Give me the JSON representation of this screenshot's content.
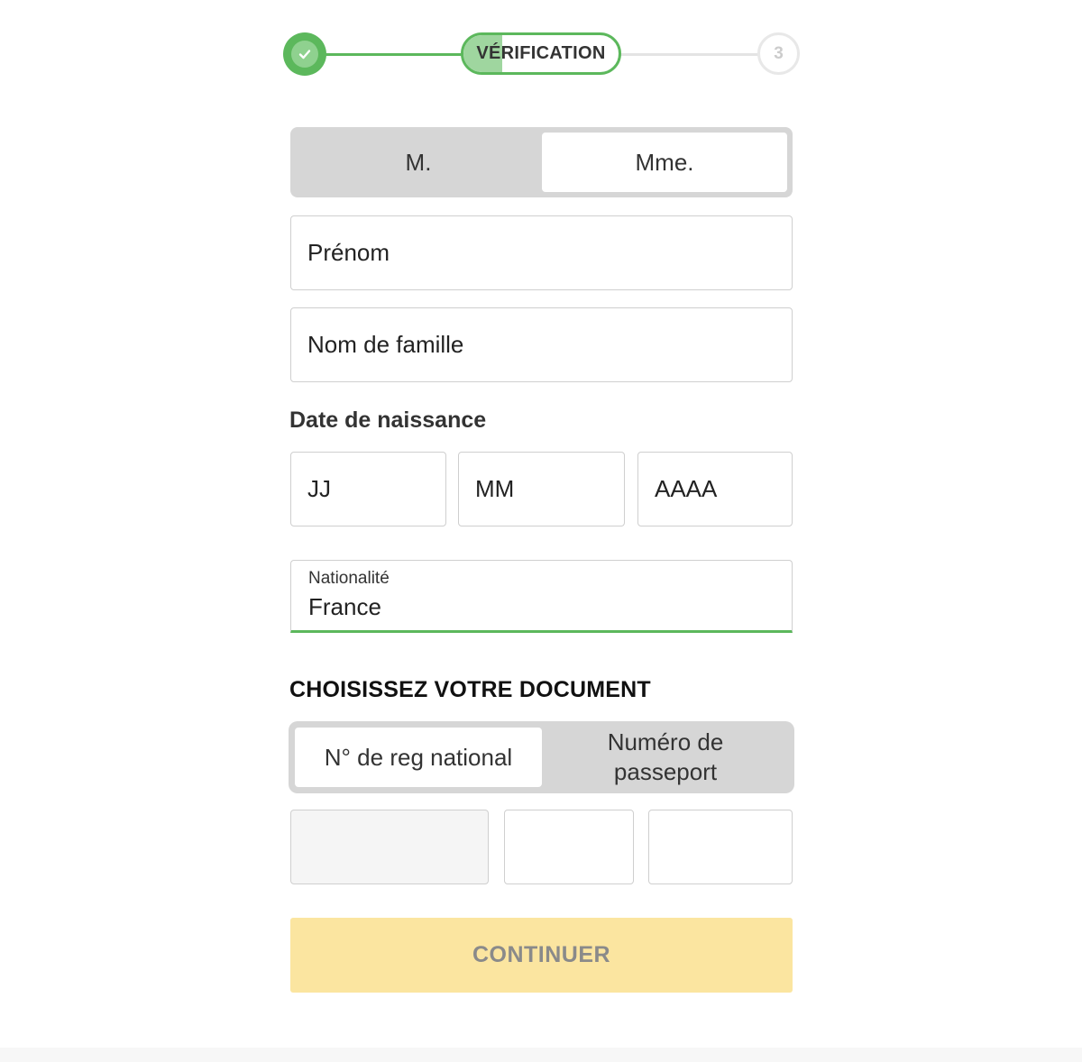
{
  "stepper": {
    "current_label": "VÉRIFICATION",
    "future_step_number": "3",
    "completed_icon": "check-icon",
    "current_progress_percent": 25
  },
  "civility": {
    "options": [
      "M.",
      "Mme."
    ],
    "selected": "Mme."
  },
  "form": {
    "first_name_placeholder": "Prénom",
    "last_name_placeholder": "Nom de famille",
    "birth_date_label": "Date de naissance",
    "day_placeholder": "JJ",
    "month_placeholder": "MM",
    "year_placeholder": "AAAA",
    "nationality_label": "Nationalité",
    "nationality_value": "France"
  },
  "document": {
    "title": "CHOISISSEZ VOTRE DOCUMENT",
    "options": [
      "N° de reg national",
      "Numéro de passeport"
    ],
    "selected": "N° de reg national"
  },
  "continue_label": "CONTINUER",
  "colors": {
    "accent_green": "#5cb85c",
    "continue_bg": "#fbe5a0",
    "segment_bg": "#d6d6d6"
  }
}
